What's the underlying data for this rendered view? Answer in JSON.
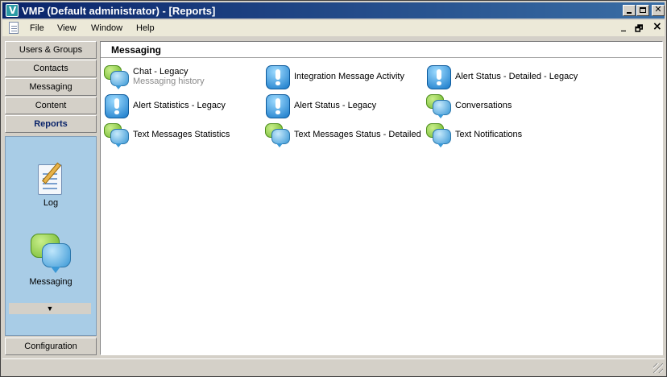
{
  "window": {
    "title": "VMP (Default administrator) - [Reports]",
    "app_icon": "V",
    "caption_buttons": [
      "minimize-icon",
      "maximize-icon",
      "close-icon"
    ]
  },
  "menubar": {
    "items": [
      "File",
      "View",
      "Window",
      "Help"
    ],
    "mdi_minimize": "_",
    "mdi_restore": "🗗",
    "mdi_close": "×"
  },
  "nav": {
    "buttons": [
      {
        "label": "Users & Groups",
        "active": false
      },
      {
        "label": "Contacts",
        "active": false
      },
      {
        "label": "Messaging",
        "active": false
      },
      {
        "label": "Content",
        "active": false
      },
      {
        "label": "Reports",
        "active": true
      }
    ],
    "pane_items": [
      {
        "label": "Log",
        "icon": "log-icon"
      },
      {
        "label": "Messaging",
        "icon": "messaging-icon"
      }
    ],
    "scroll_glyph": "▼",
    "bottom_button": "Configuration"
  },
  "main": {
    "header": "Messaging",
    "reports": [
      {
        "name": "Chat - Legacy",
        "sub": "Messaging history",
        "icon": "chat"
      },
      {
        "name": "Integration Message Activity",
        "sub": "",
        "icon": "alert"
      },
      {
        "name": "Alert Status - Detailed - Legacy",
        "sub": "",
        "icon": "alert"
      },
      {
        "name": "Alert Statistics - Legacy",
        "sub": "",
        "icon": "alert"
      },
      {
        "name": "Alert Status - Legacy",
        "sub": "",
        "icon": "alert"
      },
      {
        "name": "Conversations",
        "sub": "",
        "icon": "chat"
      },
      {
        "name": "Text Messages Statistics",
        "sub": "",
        "icon": "chat"
      },
      {
        "name": "Text Messages Status - Detailed",
        "sub": "",
        "icon": "chat"
      },
      {
        "name": "Text Notifications",
        "sub": "",
        "icon": "chat"
      }
    ]
  },
  "colors": {
    "titlebar_start": "#0a246a",
    "titlebar_end": "#3a6ea5",
    "nav_pane": "#a8cce6",
    "active_nav_text": "#0a246a"
  }
}
